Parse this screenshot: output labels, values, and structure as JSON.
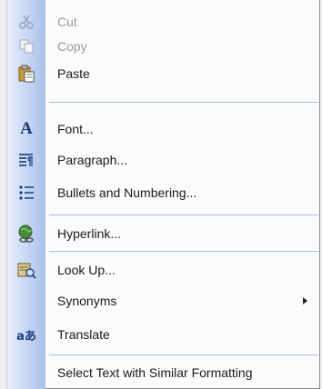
{
  "menu": {
    "items": [
      {
        "label": "Cut",
        "icon": "scissors-icon",
        "enabled": false
      },
      {
        "label": "Copy",
        "icon": "copy-icon",
        "enabled": false
      },
      {
        "label": "Paste",
        "icon": "paste-icon",
        "enabled": true
      },
      {
        "label": "Font...",
        "icon": "font-icon",
        "enabled": true
      },
      {
        "label": "Paragraph...",
        "icon": "paragraph-icon",
        "enabled": true
      },
      {
        "label": "Bullets and Numbering...",
        "icon": "bullets-icon",
        "enabled": true
      },
      {
        "label": "Hyperlink...",
        "icon": "hyperlink-icon",
        "enabled": true
      },
      {
        "label": "Look Up...",
        "icon": "research-icon",
        "enabled": true
      },
      {
        "label": "Synonyms",
        "icon": "",
        "enabled": true,
        "submenu": true
      },
      {
        "label": "Translate",
        "icon": "translate-icon",
        "enabled": true
      },
      {
        "label": "Select Text with Similar Formatting",
        "icon": "",
        "enabled": true
      }
    ],
    "icon_glyphs": {
      "font": "A",
      "translate": "aあ"
    },
    "colors": {
      "gutter": "#c8d8f4",
      "separator": "#a7bfe6",
      "disabled_text": "#9a9a9a"
    }
  }
}
